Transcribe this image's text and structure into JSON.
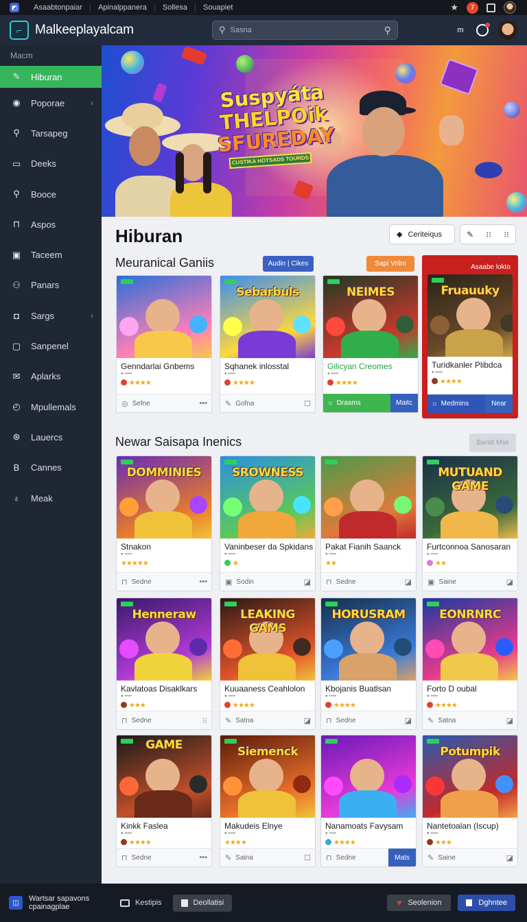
{
  "browser": {
    "links": [
      "Asaabtonpaiar",
      "Apinalppanera",
      "Sollesa",
      "Souapiet"
    ],
    "notification_count": "7"
  },
  "header": {
    "app_title": "Malkeeplayalcam",
    "search_placeholder": "Sasna",
    "shortcut_label": "m"
  },
  "sidebar": {
    "heading": "Macm",
    "items": [
      {
        "label": "Hiburan",
        "icon": "controller-icon",
        "glyph": "✎",
        "active": true
      },
      {
        "label": "Poporae",
        "icon": "circle-icon",
        "glyph": "◉",
        "chevron": true
      },
      {
        "label": "Tarsapeg",
        "icon": "search-icon",
        "glyph": "⚲"
      },
      {
        "label": "Deeks",
        "icon": "folder-icon",
        "glyph": "▭"
      },
      {
        "label": "Booce",
        "icon": "search-icon",
        "glyph": "⚲"
      },
      {
        "label": "Aspos",
        "icon": "bag-icon",
        "glyph": "⊓"
      },
      {
        "label": "Taceem",
        "icon": "screen-icon",
        "glyph": "▣"
      },
      {
        "label": "Panars",
        "icon": "people-icon",
        "glyph": "⚇"
      },
      {
        "label": "Sargs",
        "icon": "tag-icon",
        "glyph": "◘",
        "chevron": true
      },
      {
        "label": "Sanpenel",
        "icon": "window-icon",
        "glyph": "▢"
      },
      {
        "label": "Aplarks",
        "icon": "mail-icon",
        "glyph": "✉"
      },
      {
        "label": "Mpullemals",
        "icon": "clock-icon",
        "glyph": "◴"
      },
      {
        "label": "Lauercs",
        "icon": "compass-icon",
        "glyph": "⊛"
      },
      {
        "label": "Cannes",
        "icon": "b-icon",
        "glyph": "B"
      },
      {
        "label": "Meak",
        "icon": "pin-icon",
        "glyph": "♁"
      }
    ]
  },
  "hero": {
    "title_lines": [
      "Suspyáta",
      "THELPOik",
      "SFUREDAY"
    ],
    "banner": "CUSTIKA HOTSADS TOURDS"
  },
  "page": {
    "title": "Hiburan",
    "category_button": "Ceriteiqus"
  },
  "sections": [
    {
      "title": "Meuranical Ganiis",
      "buttons": [
        "Audin | Cikes",
        "Sapi Vrilm",
        "Asaabe lokto"
      ],
      "cards": [
        {
          "name": "Genndarlai Gnbems",
          "thumb_text": "",
          "stars": "★★★★",
          "dot": "#e2402f",
          "foot": "Sefne",
          "foot_icon": "gamepad-icon",
          "right": "•••"
        },
        {
          "name": "Sqhanek inlosstal",
          "thumb_text": "Sebarbuls",
          "stars": "★★★★",
          "dot": "#e2402f",
          "foot": "Gofna",
          "foot_icon": "pen-icon",
          "right": "☐"
        },
        {
          "name": "Gilicyan Creomes",
          "thumb_text": "NEIMES",
          "stars": "★★★★",
          "dot": "#e2402f",
          "foot": "Draams",
          "foot_icon": "circle-icon",
          "button": "Maitc",
          "variant": "green"
        },
        {
          "name": "Turidkanler Plibdca",
          "thumb_text": "Fruauuky",
          "stars": "★★★★",
          "dot": "#8b3a1f",
          "foot": "Medmins",
          "foot_icon": "circle-icon",
          "button": "Near",
          "variant": "red"
        }
      ]
    },
    {
      "title": "Newar Saisapa Inenics",
      "buttons": [
        "Bantit Mss"
      ],
      "cards": [
        {
          "name": "Stnakon",
          "thumb_text": "DOMMINIES",
          "stars": "★★★★★",
          "dot": "",
          "foot": "Sedne",
          "foot_icon": "bag-icon",
          "right": "•••"
        },
        {
          "name": "Vaninbeser da Spkidans",
          "thumb_text": "SROWNESS",
          "stars": "★",
          "dot": "#2ecf5a",
          "foot": "Sodin",
          "foot_icon": "window-icon",
          "right": "◪"
        },
        {
          "name": "Pakat Fianih Saanck",
          "thumb_text": "",
          "stars": "★★",
          "dot": "",
          "foot": "Sedne",
          "foot_icon": "bag-icon",
          "right": "◪"
        },
        {
          "name": "Furtconnoa Sanosaran",
          "thumb_text": "MUTUAND GAME",
          "stars": "★★",
          "dot": "#d97ad6",
          "foot": "Saine",
          "foot_icon": "window-icon",
          "right": "◪"
        },
        {
          "name": "Kavlatoas Disaklkars",
          "thumb_text": "Henneraw",
          "stars": "★★★",
          "dot": "#8b3a1f",
          "foot": "Sedne",
          "foot_icon": "bag-icon",
          "right": "⁝⁝"
        },
        {
          "name": "Kuuaaness Ceahlolon",
          "thumb_text": "LEAKING GAMS",
          "stars": "★★★★",
          "dot": "#e2402f",
          "foot": "Satna",
          "foot_icon": "pen-icon",
          "right": "◪"
        },
        {
          "name": "Kbojanis Buatlsan",
          "thumb_text": "HORUSRAM",
          "stars": "★★★★",
          "dot": "#e2402f",
          "foot": "Sedne",
          "foot_icon": "bag-icon",
          "right": "◪"
        },
        {
          "name": "Forto D oubal",
          "thumb_text": "EONRNRC",
          "stars": "★★★★",
          "dot": "#e2402f",
          "foot": "Satna",
          "foot_icon": "pen-icon",
          "right": "◪"
        },
        {
          "name": "Kinkk Faslea",
          "thumb_text": "GAME",
          "stars": "★★★★",
          "dot": "#8b3a1f",
          "foot": "Sedne",
          "foot_icon": "bag-icon",
          "right": "•••"
        },
        {
          "name": "Makudeis Elnye",
          "thumb_text": "Siemenck",
          "stars": "★★★★",
          "dot": "",
          "foot": "Saina",
          "foot_icon": "pen-icon",
          "right": "☐"
        },
        {
          "name": "Nanamoats Favysam",
          "thumb_text": "",
          "stars": "★★★★",
          "dot": "#3ea3d8",
          "foot": "Sedne",
          "foot_icon": "bag-icon",
          "button": "Mats"
        },
        {
          "name": "Nantetoalan (Iscup)",
          "thumb_text": "Potumpik",
          "stars": "★★★",
          "dot": "#8b3a1f",
          "foot": "Saine",
          "foot_icon": "pen-icon",
          "right": "◪"
        }
      ]
    }
  ],
  "bottombar": {
    "text": "Wartsar sapavons cpainagplae",
    "btn1": "Kestipis",
    "btn2": "Deollatisi",
    "btn3": "Seolenion",
    "btn4": "Dghntee"
  }
}
